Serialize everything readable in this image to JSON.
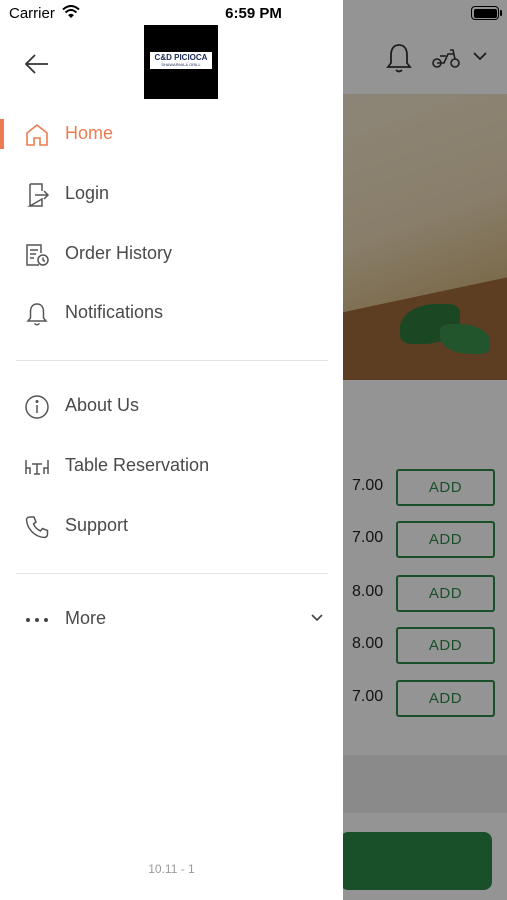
{
  "status_bar": {
    "carrier": "Carrier",
    "time": "6:59 PM"
  },
  "logo": {
    "line1": "C&D PICIOCA",
    "line2": "SHAWARMA & GRILL"
  },
  "drawer": {
    "menu": [
      {
        "label": "Home",
        "icon": "home-icon",
        "active": true
      },
      {
        "label": "Login",
        "icon": "login-icon"
      },
      {
        "label": "Order History",
        "icon": "order-history-icon"
      },
      {
        "label": "Notifications",
        "icon": "bell-icon"
      },
      {
        "label": "About Us",
        "icon": "info-icon"
      },
      {
        "label": "Table Reservation",
        "icon": "table-icon"
      },
      {
        "label": "Support",
        "icon": "phone-icon"
      },
      {
        "label": "More",
        "icon": "more-dots-icon"
      }
    ],
    "version": "10.11 - 1"
  },
  "background": {
    "items": [
      {
        "price": "7.00",
        "button": "ADD"
      },
      {
        "price": "7.00",
        "button": "ADD"
      },
      {
        "price": "8.00",
        "button": "ADD"
      },
      {
        "price": "8.00",
        "button": "ADD"
      },
      {
        "price": "7.00",
        "button": "ADD"
      }
    ]
  },
  "colors": {
    "accent": "#ee7c52",
    "green": "#2e8b47",
    "text": "#4a4a4a"
  }
}
